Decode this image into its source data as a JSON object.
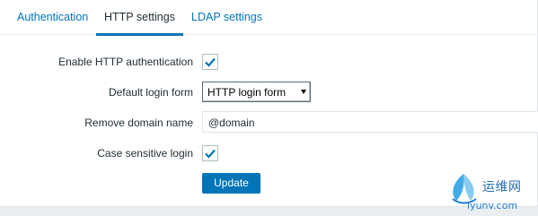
{
  "tabs": [
    {
      "label": "Authentication",
      "active": false
    },
    {
      "label": "HTTP settings",
      "active": true
    },
    {
      "label": "LDAP settings",
      "active": false
    }
  ],
  "form": {
    "enable_http_auth": {
      "label": "Enable HTTP authentication",
      "checked": true
    },
    "default_login_form": {
      "label": "Default login form",
      "value": "HTTP login form"
    },
    "remove_domain_name": {
      "label": "Remove domain name",
      "value": "@domain"
    },
    "case_sensitive_login": {
      "label": "Case sensitive login",
      "checked": true
    },
    "update_label": "Update"
  },
  "watermark": {
    "line1": "运维网",
    "line2": "iyunv.com"
  },
  "colors": {
    "accent": "#0275b8",
    "text": "#1f2c33",
    "background": "#ebeef0"
  },
  "icons": {
    "checkbox_check": "checkmark-icon",
    "select_arrow": "dropdown-arrow-icon"
  }
}
